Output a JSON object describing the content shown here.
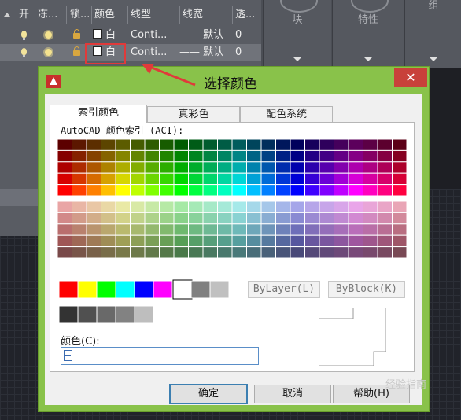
{
  "layers_panel": {
    "columns": [
      "开",
      "冻...",
      "锁...",
      "颜色",
      "线型",
      "线宽",
      "透..."
    ],
    "rows": [
      {
        "color": "白",
        "linetype": "Conti...",
        "lineweight": "默认",
        "transparency": "0"
      },
      {
        "color": "白",
        "linetype": "Conti...",
        "lineweight": "默认",
        "transparency": "0"
      }
    ]
  },
  "toolbar": {
    "groups": [
      "块",
      "特性",
      "组"
    ]
  },
  "annotation": {
    "text": "选择颜色",
    "color": "#e03a3a"
  },
  "dialog": {
    "close_label": "✕",
    "tabs": [
      "索引颜色",
      "真彩色",
      "配色系统"
    ],
    "active_tab": "索引颜色",
    "aci_label": "AutoCAD 颜色索引 (ACI):",
    "standard_colors": [
      "#ff0000",
      "#ffff00",
      "#00ff00",
      "#00ffff",
      "#0000ff",
      "#ff00ff",
      "#ffffff",
      "#808080",
      "#c0c0c0"
    ],
    "gray_colors": [
      "#333333",
      "#505050",
      "#696969",
      "#828282",
      "#bebebe",
      "#ffffff"
    ],
    "bylayer_label": "ByLayer(L)",
    "byblock_label": "ByBlock(K)",
    "color_label": "颜色(C):",
    "color_value": "",
    "buttons": {
      "ok": "确定",
      "cancel": "取消",
      "help": "帮助(H)"
    }
  },
  "watermark": "经验指南"
}
